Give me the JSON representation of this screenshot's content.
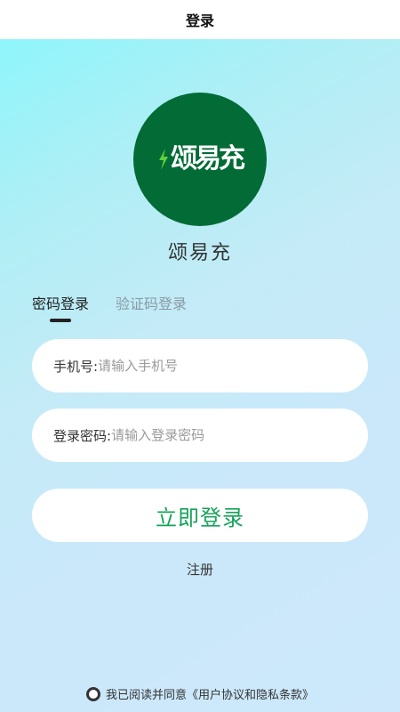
{
  "header": {
    "title": "登录"
  },
  "logo": {
    "text": "颂易充",
    "icon": "lightning-bolt-icon"
  },
  "brand": {
    "name": "颂易充"
  },
  "tabs": [
    {
      "label": "密码登录",
      "active": true
    },
    {
      "label": "验证码登录",
      "active": false
    }
  ],
  "form": {
    "phone": {
      "label": "手机号:",
      "placeholder": "请输入手机号",
      "value": ""
    },
    "password": {
      "label": "登录密码:",
      "placeholder": "请输入登录密码",
      "value": ""
    },
    "submit_label": "立即登录"
  },
  "register_label": "注册",
  "agreement": {
    "prefix": "我已阅读并同意",
    "link_text": "《用户协议和隐私条款》",
    "checked": false
  },
  "colors": {
    "brand_green": "#036b35",
    "button_text_green": "#16a35a",
    "gradient_top": "#8ef6fb",
    "gradient_bottom": "#cde8fb"
  }
}
